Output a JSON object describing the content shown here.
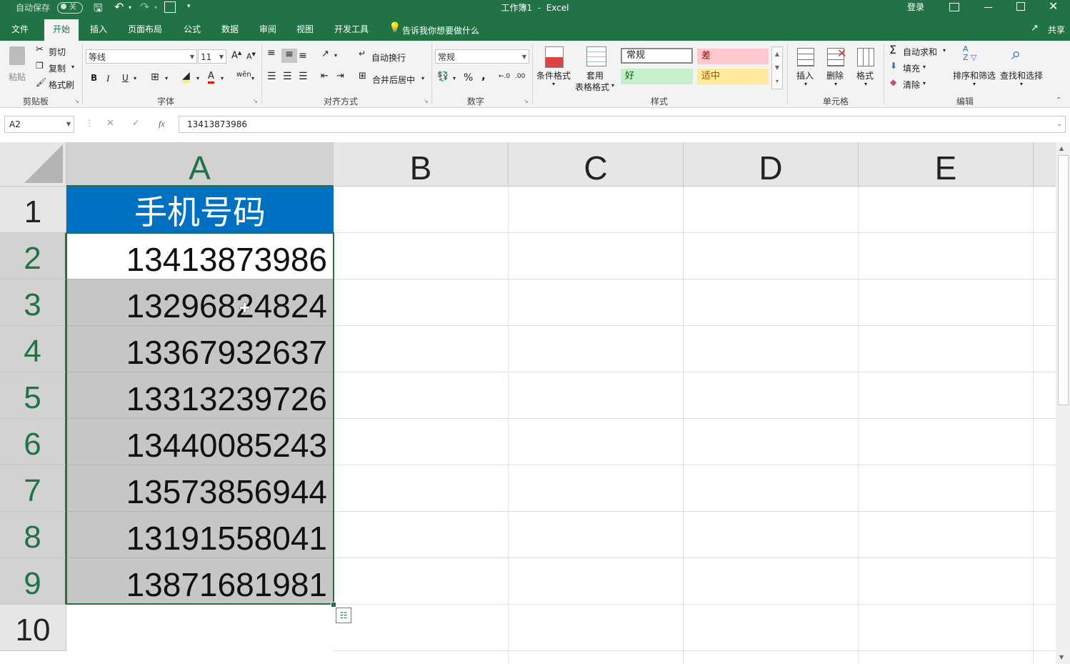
{
  "titlebar": {
    "autosave_label": "自动保存",
    "autosave_state": "关",
    "title": "工作簿1  -  Excel",
    "login": "登录"
  },
  "tabs": [
    "文件",
    "开始",
    "插入",
    "页面布局",
    "公式",
    "数据",
    "审阅",
    "视图",
    "开发工具"
  ],
  "active_tab_index": 1,
  "tell_me": "告诉我你想要做什么",
  "share": "共享",
  "ribbon": {
    "clipboard": {
      "label": "剪贴板",
      "paste": "粘贴",
      "cut": "剪切",
      "copy": "复制",
      "format_painter": "格式刷"
    },
    "font": {
      "label": "字体",
      "name": "等线",
      "size": "11",
      "bold": "B",
      "italic": "I",
      "underline": "U"
    },
    "alignment": {
      "label": "对齐方式",
      "wrap": "自动换行",
      "merge": "合并后居中"
    },
    "number": {
      "label": "数字",
      "format": "常规",
      "percent": "%",
      "comma": ","
    },
    "styles": {
      "label": "样式",
      "conditional": "条件格式",
      "table_format_1": "套用",
      "table_format_2": "表格格式",
      "normal": "常规",
      "bad": "差",
      "good": "好",
      "neutral": "适中"
    },
    "cells": {
      "label": "单元格",
      "insert": "插入",
      "delete": "删除",
      "format": "格式"
    },
    "editing": {
      "label": "编辑",
      "autosum": "自动求和",
      "fill": "填充",
      "clear": "清除",
      "sort": "排序和筛选",
      "find": "查找和选择"
    }
  },
  "formula_bar": {
    "name_box": "A2",
    "fx": "fx",
    "content": "13413873986"
  },
  "columns": [
    "A",
    "B",
    "C",
    "D",
    "E"
  ],
  "rows": [
    "1",
    "2",
    "3",
    "4",
    "5",
    "6",
    "7",
    "8",
    "9",
    "10"
  ],
  "cells": {
    "header": "手机号码",
    "values": [
      "13413873986",
      "13296824824",
      "13367932637",
      "13313239726",
      "13440085243",
      "13573856944",
      "13191558041",
      "13871681981"
    ]
  },
  "colors": {
    "excel_green": "#217346",
    "header_fill": "#0070c0",
    "selection_fill": "#c6c6c6"
  }
}
